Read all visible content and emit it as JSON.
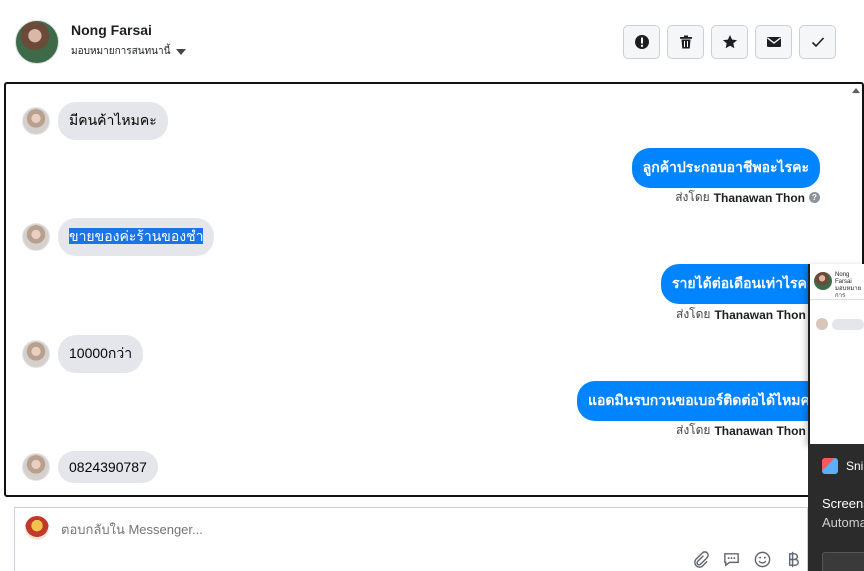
{
  "header": {
    "contact_name": "Nong Farsai",
    "assign_label": "มอบหมายการสนทนานี้",
    "actions": [
      {
        "name": "mark-spam-button",
        "icon": "exclamation-icon"
      },
      {
        "name": "delete-button",
        "icon": "trash-icon"
      },
      {
        "name": "star-button",
        "icon": "star-icon"
      },
      {
        "name": "mark-unread-button",
        "icon": "envelope-icon"
      },
      {
        "name": "mark-done-button",
        "icon": "check-icon"
      }
    ]
  },
  "thread": {
    "messages": [
      {
        "dir": "in",
        "text": "มีคนค้าไหมคะ"
      },
      {
        "dir": "out",
        "text": "ลูกค้าประกอบอาชีพอะไรคะ",
        "sent_by_label": "ส่งโดย",
        "sender": "Thanawan Thon"
      },
      {
        "dir": "in",
        "text": "ขายของค่ะร้านของชำ",
        "selected": true
      },
      {
        "dir": "out",
        "text": "รายได้ต่อเดือนเท่าไรคะ",
        "sent_by_label": "ส่งโดย",
        "sender": "Thanawan Thon"
      },
      {
        "dir": "in",
        "text": "10000กว่า"
      },
      {
        "dir": "out",
        "text": "แอดมินรบกวนขอเบอร์ติดต่อได้ไหมคะ",
        "sent_by_label": "ส่งโดย",
        "sender": "Thanawan Thon"
      },
      {
        "dir": "in",
        "text": "0824390787"
      }
    ]
  },
  "popup": {
    "name": "Nong Farsai",
    "sub": "มอบหมายการ"
  },
  "toast": {
    "app": "Snipping Tool",
    "line1": "Screenshot copied to clipboard",
    "line2": "Automatically saved to screenshots folder"
  },
  "composer": {
    "placeholder": "ตอบกลับใน Messenger..."
  },
  "colors": {
    "outgoing_bubble": "#0084ff",
    "incoming_bubble": "#e4e6eb"
  }
}
